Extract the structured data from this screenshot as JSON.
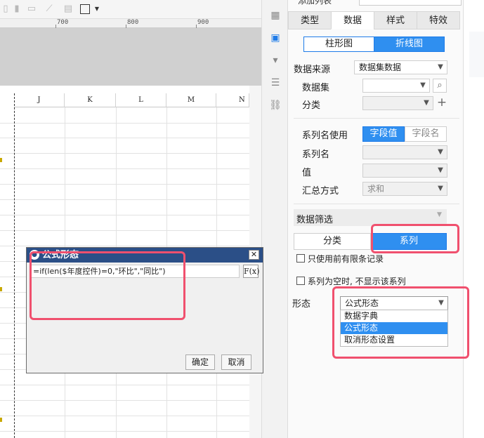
{
  "ruler": {
    "labels": [
      "700",
      "800",
      "900"
    ]
  },
  "sheet": {
    "columns": [
      "J",
      "K",
      "L",
      "M",
      "N"
    ]
  },
  "side_icons": [
    "layout-icon",
    "chart-frame-icon",
    "widget-icon",
    "list-icon",
    "link-icon"
  ],
  "panel": {
    "top_field_label": "添加列表",
    "tabs": [
      "类型",
      "数据",
      "样式",
      "特效"
    ],
    "active_tab": "数据",
    "chart_types": [
      "柱形图",
      "折线图"
    ],
    "data_source_label": "数据来源",
    "data_source_value": "数据集数据",
    "dataset_label": "数据集",
    "dataset_value": "",
    "category_label": "分类",
    "category_value": "",
    "series_name_use_label": "系列名使用",
    "series_name_options": [
      "字段值",
      "字段名"
    ],
    "series_name_label": "系列名",
    "value_label": "值",
    "summary_label": "汇总方式",
    "summary_value": "求和",
    "filter_title": "数据筛选",
    "filter_tabs": [
      "分类",
      "系列"
    ],
    "only_prev_label": "只使用前有限条记录",
    "hide_empty_label": "系列为空时, 不显示该系列",
    "form_label": "形态",
    "form_value": "公式形态",
    "form_options": [
      "数据字典",
      "公式形态",
      "取消形态设置"
    ]
  },
  "dialog": {
    "title": "公式形态",
    "close": "✕",
    "formula": "=if(len($年度控件)=0,\"环比\",\"同比\")",
    "fx": "F(x)",
    "ok": "确定",
    "cancel": "取消"
  },
  "colors": {
    "accent": "#2f8ff0",
    "annotation": "#f0506e",
    "dialog_title": "#2b4f87"
  }
}
